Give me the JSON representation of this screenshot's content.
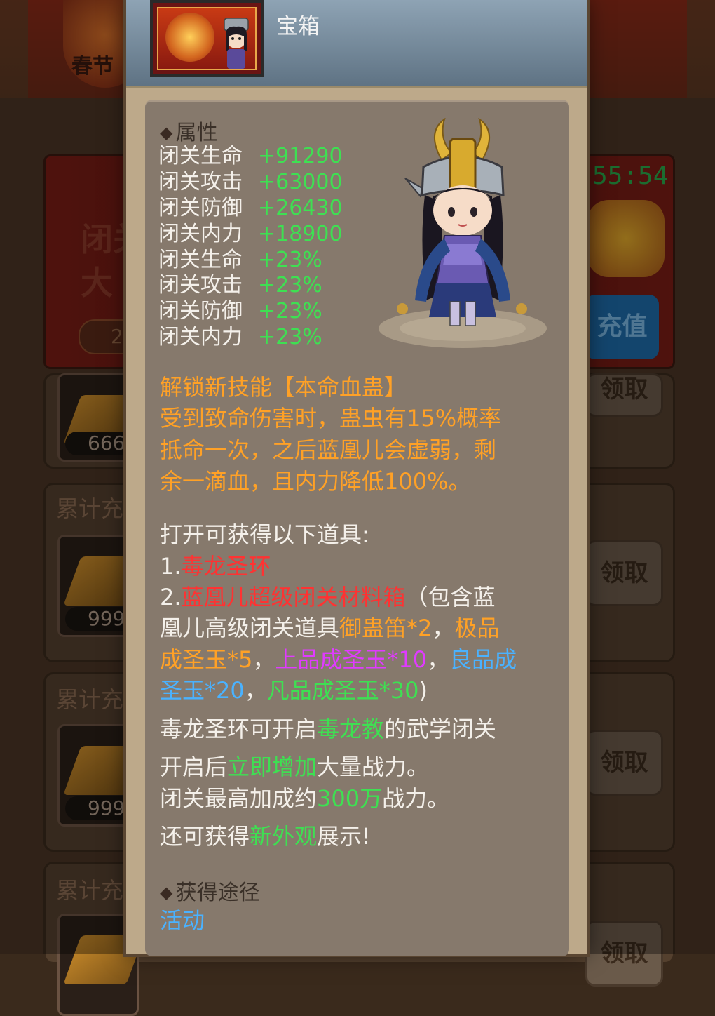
{
  "background": {
    "top_badge": "春节",
    "banner_text": "闭关\n大",
    "banner_pill": "2",
    "timer": "55:54",
    "recharge_button": "充值",
    "rows": [
      {
        "header": "",
        "count": "666",
        "button": "领取"
      },
      {
        "header": "累计充",
        "count": "999",
        "button": "领取"
      },
      {
        "header": "累计充",
        "count": "999",
        "button": "领取"
      },
      {
        "header": "累计充",
        "count": "",
        "button": "领取"
      }
    ]
  },
  "popup": {
    "title": "宝箱",
    "attributes_header": "属性",
    "stats": [
      {
        "name": "闭关生命",
        "value": "+91290"
      },
      {
        "name": "闭关攻击",
        "value": "+63000"
      },
      {
        "name": "闭关防御",
        "value": "+26430"
      },
      {
        "name": "闭关内力",
        "value": "+18900"
      },
      {
        "name": "闭关生命",
        "value": "+23%"
      },
      {
        "name": "闭关攻击",
        "value": "+23%"
      },
      {
        "name": "闭关防御",
        "value": "+23%"
      },
      {
        "name": "闭关内力",
        "value": "+23%"
      }
    ],
    "skill": {
      "unlock": "解锁新技能【本命血蛊】",
      "line1": "受到致命伤害时，蛊虫有15%概率",
      "line2": "抵命一次，之后蓝凰儿会虚弱，剩",
      "line3": "余一滴血，且内力降低100%。"
    },
    "contents": {
      "intro": "打开可获得以下道具:",
      "item1_num": "1.",
      "item1_name": "毒龙圣环",
      "item2_num": "2.",
      "item2_name": "蓝凰儿超级闭关材料箱",
      "item2_desc_a": "（包含蓝",
      "item2_desc_b": "凰儿高级闭关道具",
      "flute": "御蛊笛*2",
      "comma1": "，",
      "jade_top_a": "极品",
      "jade_top_b": "成圣玉*5",
      "comma2": "，",
      "jade_high": "上品成圣玉*10",
      "comma3": "，",
      "jade_good_a": "良品成",
      "jade_good_b": "圣玉*20",
      "comma4": "，",
      "jade_common": "凡品成圣玉*30",
      "close_paren": ")"
    },
    "unlock_info": {
      "l1_a": "毒龙圣环可开启",
      "l1_sect": "毒龙教",
      "l1_b": "的武学闭关",
      "l2_a": "开启后",
      "l2_highlight": "立即增加",
      "l2_b": "大量战力。",
      "l3_a": "闭关最高加成约",
      "l3_highlight": "300万",
      "l3_b": "战力。",
      "l4_a": "还可获得",
      "l4_highlight": "新外观",
      "l4_b": "展示!"
    },
    "source_header": "获得途径",
    "source_link": "活动"
  }
}
